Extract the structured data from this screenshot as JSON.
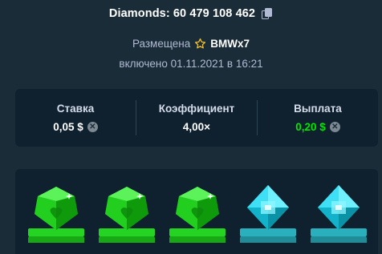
{
  "header": {
    "game_title": "Diamonds: 60 479 108 462",
    "copy_icon": "copy-icon"
  },
  "bet_info": {
    "placed_label": "Размещена",
    "user_icon": "star-icon",
    "username": "BMWx7",
    "enabled_text": "включено 01.11.2021 в 16:21"
  },
  "stats": {
    "bet_label": "Ставка",
    "bet_value": "0,05 $",
    "multiplier_label": "Коэффициент",
    "multiplier_value": "4,00×",
    "payout_label": "Выплата",
    "payout_value": "0,20 $",
    "currency_icon": "coin-icon",
    "payout_color": "#00e701"
  },
  "board": {
    "gems": [
      {
        "type": "green",
        "color": "#1fde1a",
        "highlighted": true
      },
      {
        "type": "green",
        "color": "#1fde1a",
        "highlighted": true
      },
      {
        "type": "green",
        "color": "#1fde1a",
        "highlighted": true
      },
      {
        "type": "cyan",
        "color": "#1fd8f0",
        "highlighted": false
      },
      {
        "type": "cyan",
        "color": "#1fd8f0",
        "highlighted": false
      }
    ]
  },
  "colors": {
    "background": "#1a2c38",
    "panel": "#0f212e",
    "green_pad": "#1fd11c",
    "cyan_pad": "#2aa5b2"
  }
}
